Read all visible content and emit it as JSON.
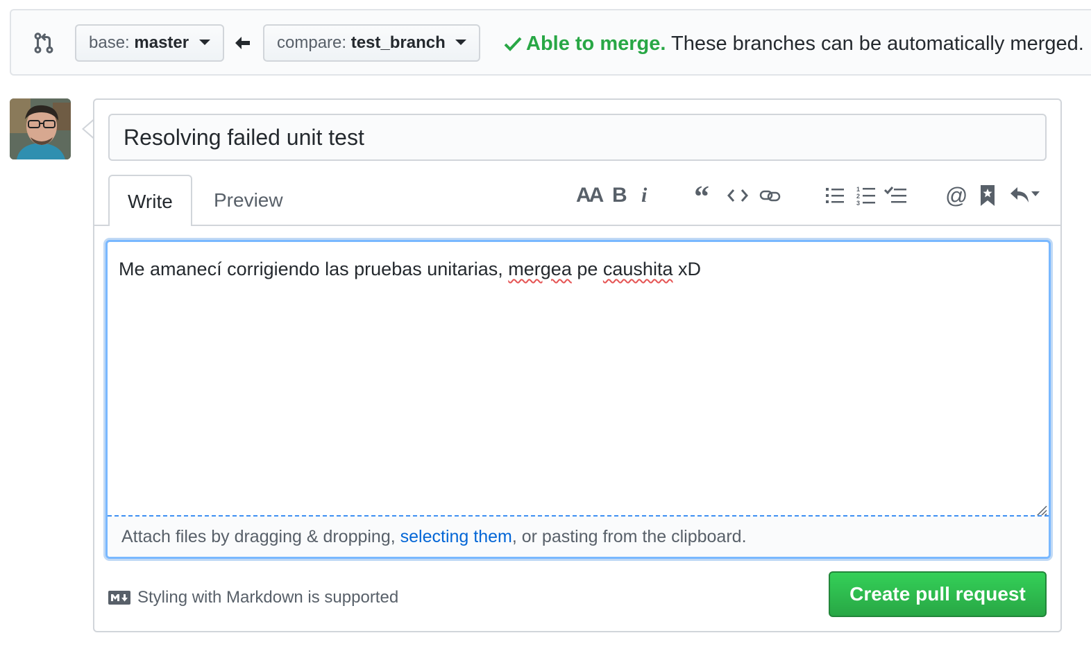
{
  "compare": {
    "base_label": "base:",
    "base_branch": "master",
    "compare_label": "compare:",
    "compare_branch": "test_branch",
    "merge_ok": "Able to merge.",
    "merge_detail": "These branches can be automatically merged."
  },
  "form": {
    "title_value": "Resolving failed unit test",
    "tabs": [
      {
        "label": "Write",
        "active": true
      },
      {
        "label": "Preview",
        "active": false
      }
    ],
    "toolbar": {
      "heading": "AA",
      "bold": "B",
      "italic": "i",
      "quote_icon": "quote-icon",
      "code_icon": "code-icon",
      "link_icon": "link-icon",
      "ul_icon": "unordered-list-icon",
      "ol_icon": "ordered-list-icon",
      "task_icon": "task-list-icon",
      "mention": "@",
      "ref_icon": "bookmark-icon",
      "reply_icon": "reply-icon"
    },
    "body": {
      "part1": "Me amanecí corrigiendo las pruebas unitarias, ",
      "sq1": "mergea",
      "part2": " pe ",
      "sq2": "caushita",
      "part3": " xD"
    },
    "drop": {
      "before": "Attach files by dragging & dropping, ",
      "link": "selecting them",
      "after": ", or pasting from the clipboard."
    },
    "markdown_note": "Styling with Markdown is supported",
    "submit_label": "Create pull request"
  },
  "colors": {
    "success": "#28a745",
    "link": "#0366d6",
    "focus": "#79b8ff"
  }
}
